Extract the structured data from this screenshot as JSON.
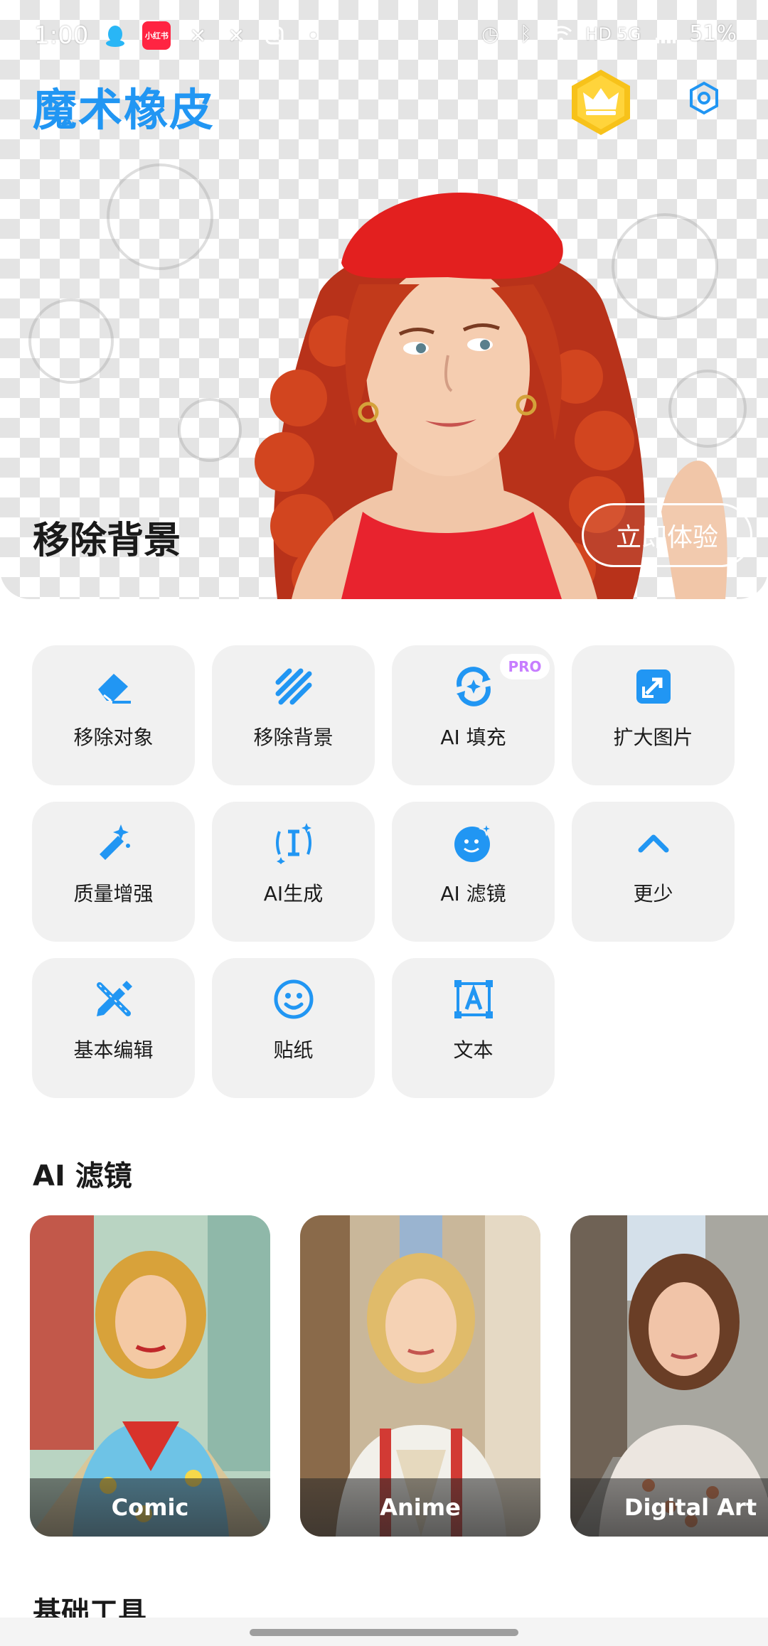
{
  "status_bar": {
    "time": "1:00",
    "left_icons": [
      "qq-icon",
      "xiaohongshu-icon",
      "x-icon",
      "x-icon",
      "instagram-icon",
      "dot-icon"
    ],
    "xhs_label": "小红书",
    "network": "HD 5G",
    "battery": "51%"
  },
  "header": {
    "app_title": "魔术橡皮"
  },
  "hero": {
    "label": "移除背景",
    "cta": "立即体验"
  },
  "tools": [
    {
      "label": "移除对象",
      "icon": "eraser-icon"
    },
    {
      "label": "移除背景",
      "icon": "stripes-icon"
    },
    {
      "label": "AI 填充",
      "icon": "ai-fill-icon",
      "badge": "PRO"
    },
    {
      "label": "扩大图片",
      "icon": "expand-image-icon"
    },
    {
      "label": "质量增强",
      "icon": "magic-wand-icon"
    },
    {
      "label": "AI生成",
      "icon": "ai-generate-icon"
    },
    {
      "label": "AI 滤镜",
      "icon": "ai-filter-face-icon"
    },
    {
      "label": "更少",
      "icon": "chevron-up-icon"
    },
    {
      "label": "基本编辑",
      "icon": "edit-tools-icon"
    },
    {
      "label": "贴纸",
      "icon": "smiley-icon"
    },
    {
      "label": "文本",
      "icon": "text-box-icon"
    }
  ],
  "ai_filters": {
    "title": "AI 滤镜",
    "items": [
      {
        "label": "Comic"
      },
      {
        "label": "Anime"
      },
      {
        "label": "Digital Art"
      }
    ]
  },
  "basic_tools": {
    "title": "基础工具"
  },
  "colors": {
    "accent": "#2196f3",
    "tile_bg": "#f1f1f1",
    "pro_badge": "#c77dff"
  }
}
